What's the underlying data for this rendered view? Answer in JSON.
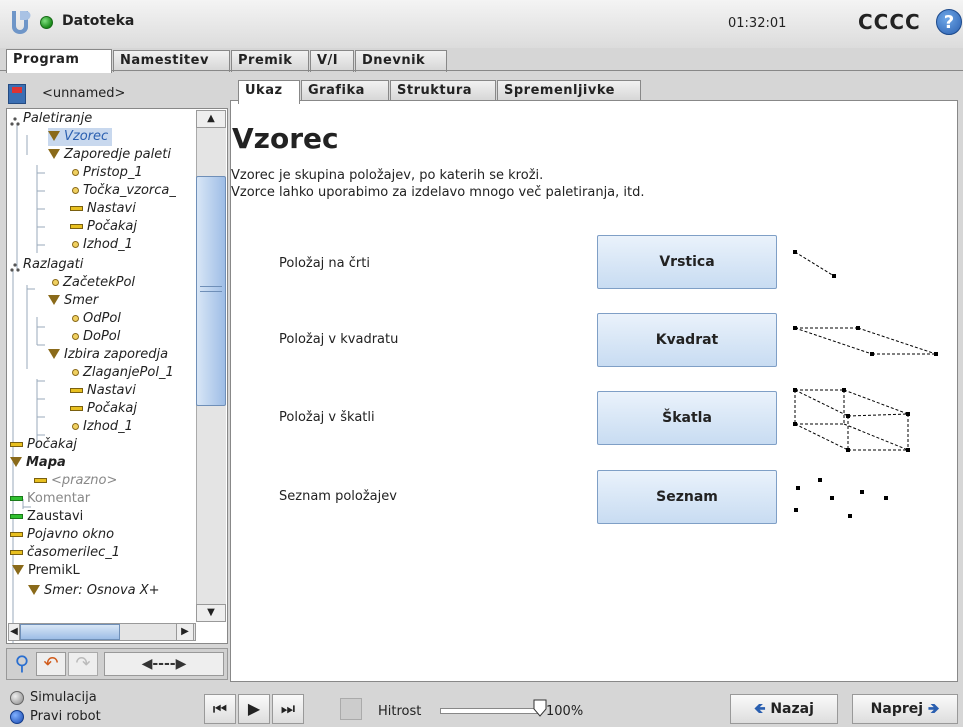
{
  "header": {
    "file_label": "Datoteka",
    "clock": "01:32:01",
    "robot_name": "CCCC",
    "help": "?"
  },
  "main_tabs": [
    {
      "label": "Program",
      "active": true
    },
    {
      "label": "Namestitev"
    },
    {
      "label": "Premik"
    },
    {
      "label": "V/I"
    },
    {
      "label": "Dnevnik"
    }
  ],
  "program": {
    "name": "<unnamed>"
  },
  "tree": [
    {
      "label": "Paletiranje",
      "icon": "pallet-icon"
    },
    {
      "label": "Vzorec",
      "icon": "triangle-icon",
      "selected": true
    },
    {
      "label": "Zaporedje paleti",
      "icon": "triangle-icon"
    },
    {
      "label": "Pristop_1",
      "icon": "waypoint-icon"
    },
    {
      "label": "Točka_vzorca_",
      "icon": "waypoint-icon"
    },
    {
      "label": "Nastavi",
      "icon": "bar-icon"
    },
    {
      "label": "Počakaj",
      "icon": "bar-icon"
    },
    {
      "label": "Izhod_1",
      "icon": "waypoint-icon"
    },
    {
      "label": "Razlagati",
      "icon": "pallet-icon"
    },
    {
      "label": "ZačetekPol",
      "icon": "waypoint-icon"
    },
    {
      "label": "Smer",
      "icon": "triangle-icon"
    },
    {
      "label": "OdPol",
      "icon": "waypoint-icon"
    },
    {
      "label": "DoPol",
      "icon": "waypoint-icon"
    },
    {
      "label": "Izbira zaporedja",
      "icon": "triangle-icon"
    },
    {
      "label": "ZlaganjePol_1",
      "icon": "waypoint-icon"
    },
    {
      "label": "Nastavi",
      "icon": "bar-icon"
    },
    {
      "label": "Počakaj",
      "icon": "bar-icon"
    },
    {
      "label": "Izhod_1",
      "icon": "waypoint-icon"
    },
    {
      "label": "Počakaj",
      "icon": "bar-icon"
    },
    {
      "label": "Mapa",
      "icon": "triangle-icon"
    },
    {
      "label": "<prazno>",
      "icon": "bar-icon"
    },
    {
      "label": "Komentar",
      "icon": "bar-icon"
    },
    {
      "label": "Zaustavi",
      "icon": "bar-icon"
    },
    {
      "label": "Pojavno okno",
      "icon": "bar-icon"
    },
    {
      "label": "časomerilec_1",
      "icon": "bar-icon"
    },
    {
      "label": "PremikL",
      "icon": "triangle-icon"
    },
    {
      "label": "Smer: Osnova X+",
      "icon": "triangle-icon"
    }
  ],
  "command_tabs": [
    {
      "label": "Ukaz",
      "active": true
    },
    {
      "label": "Grafika"
    },
    {
      "label": "Struktura"
    },
    {
      "label": "Spremenljivke"
    }
  ],
  "content": {
    "title": "Vzorec",
    "desc1": "Vzorec je skupina položajev, po katerih se kroži.",
    "desc2": "Vzorce lahko uporabimo za izdelavo mnogo več paletiranja, itd.",
    "rows": [
      {
        "label": "Položaj na črti",
        "button": "Vrstica"
      },
      {
        "label": "Položaj v kvadratu",
        "button": "Kvadrat"
      },
      {
        "label": "Položaj v škatli",
        "button": "Škatla"
      },
      {
        "label": "Seznam položajev",
        "button": "Seznam"
      }
    ]
  },
  "bottom": {
    "simulation": "Simulacija",
    "real_robot": "Pravi robot",
    "speed_label": "Hitrost",
    "speed_value": "100%",
    "speed_fraction": 1.0,
    "back": "Nazaj",
    "next": "Naprej"
  }
}
